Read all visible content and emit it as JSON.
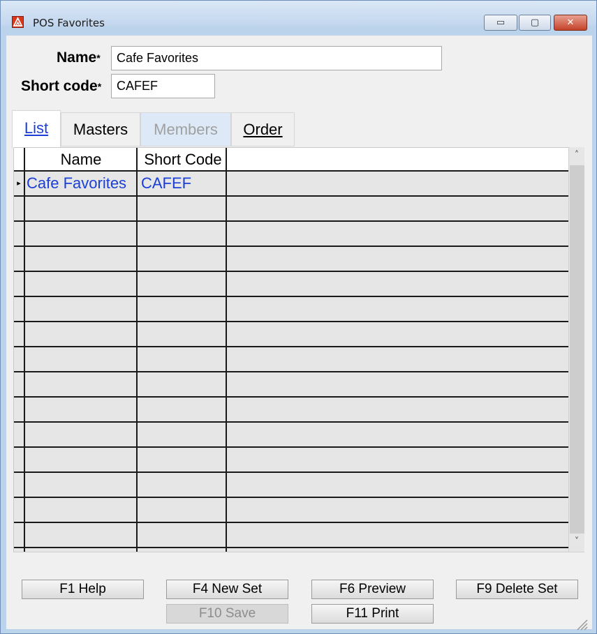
{
  "window": {
    "title": "POS Favorites",
    "controls": {
      "minimize": "▭",
      "maximize": "▢",
      "close": "✕"
    }
  },
  "form": {
    "name_label": "Name",
    "name_value": "Cafe Favorites",
    "short_code_label": "Short code",
    "short_code_value": "CAFEF",
    "required_marker": "*"
  },
  "tabs": [
    {
      "label": "List",
      "active": true,
      "disabled": false,
      "mnemonic": "L"
    },
    {
      "label": "Masters",
      "active": false,
      "disabled": false
    },
    {
      "label": "Members",
      "active": false,
      "disabled": true
    },
    {
      "label": "Order",
      "active": false,
      "disabled": false,
      "mnemonic": "O"
    }
  ],
  "grid": {
    "columns": [
      "Name",
      "Short Code"
    ],
    "rows": [
      {
        "name": "Cafe Favorites",
        "short_code": "CAFEF",
        "current": true
      }
    ],
    "scroll_up": "˄",
    "scroll_down": "˅",
    "row_indicator": "▸"
  },
  "buttons": {
    "help": "F1 Help",
    "new_set": "F4 New Set",
    "preview": "F6 Preview",
    "delete_set": "F9 Delete Set",
    "save": "F10 Save",
    "print": "F11 Print"
  },
  "colors": {
    "link_blue": "#1b3fd6",
    "close_red": "#c4422a",
    "disabled_text": "#8d8d8d"
  }
}
